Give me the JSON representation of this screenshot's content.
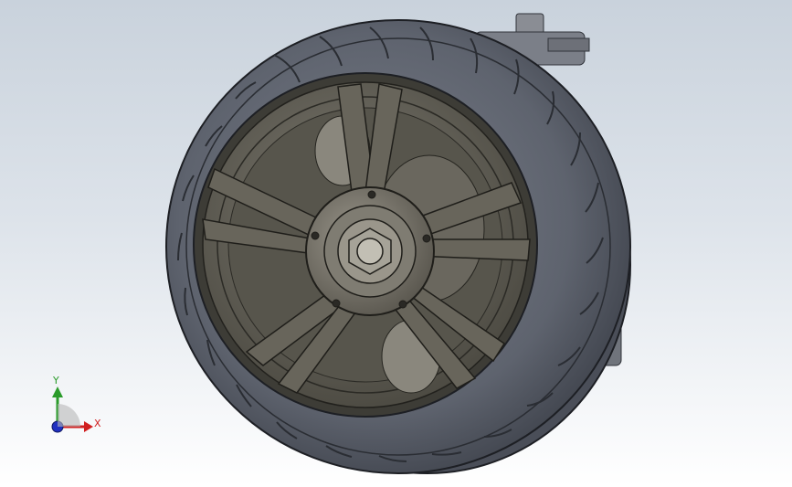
{
  "viewport": {
    "background_top": "#c9d2dc",
    "background_bottom": "#ffffff"
  },
  "model": {
    "tire_color": "#5a5e6a",
    "rim_color": "#5c5a52",
    "spring_color": "#28a028"
  },
  "triad": {
    "x_label": "X",
    "y_label": "Y",
    "x_color": "#d02020",
    "y_color": "#2a9b2a",
    "z_color": "#2030c0"
  }
}
